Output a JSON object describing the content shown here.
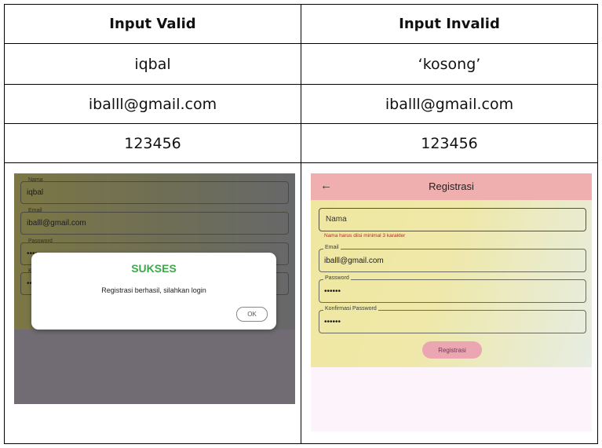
{
  "table": {
    "headers": [
      "Input Valid",
      "Input Invalid"
    ],
    "rows": [
      [
        "iqbal",
        "‘kosong’"
      ],
      [
        "iballl@gmail.com",
        "iballl@gmail.com"
      ],
      [
        "123456",
        "123456"
      ]
    ]
  },
  "valid_screen": {
    "fields": [
      {
        "label": "Nama",
        "value": "iqbal"
      },
      {
        "label": "Email",
        "value": "iballl@gmail.com"
      },
      {
        "label": "Password",
        "value": "••••"
      },
      {
        "label": "Ko",
        "value": "••"
      }
    ],
    "dialog": {
      "title": "SUKSES",
      "message": "Registrasi berhasil, silahkan login",
      "ok_label": "OK"
    }
  },
  "invalid_screen": {
    "app_bar": {
      "back_icon": "←",
      "title": "Registrasi"
    },
    "nama_placeholder": "Nama",
    "nama_error": "Nama harus diisi minimal 3 karakter",
    "email": {
      "label": "Email",
      "value": "iballl@gmail.com"
    },
    "password": {
      "label": "Password",
      "value": "••••••"
    },
    "confirm_password": {
      "label": "Konfirmasi Password",
      "value": "••••••"
    },
    "submit_label": "Registrasi"
  },
  "colors": {
    "success_title": "#3ea94a",
    "error_text": "#c0261f",
    "app_bar": "#efafaf",
    "submit_button": "#eca6b1"
  }
}
